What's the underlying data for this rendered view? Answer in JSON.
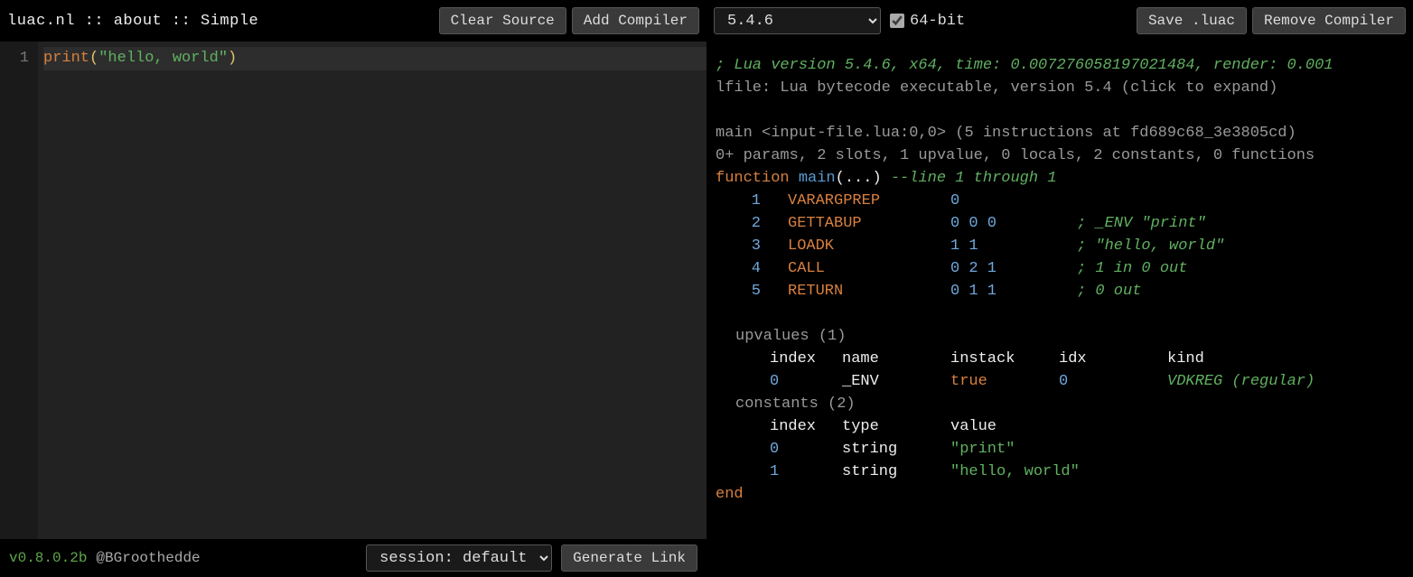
{
  "header": {
    "title": "luac.nl :: about :: Simple",
    "clear_source": "Clear Source",
    "add_compiler": "Add Compiler"
  },
  "compiler_bar": {
    "version_selected": "5.4.6",
    "arch_checked": true,
    "arch_label": "64-bit",
    "save_luac": "Save .luac",
    "remove_compiler": "Remove Compiler"
  },
  "editor": {
    "line_numbers": [
      "1"
    ],
    "code_tokens": {
      "fn": "print",
      "lparen": "(",
      "str": "\"hello, world\"",
      "rparen": ")"
    }
  },
  "footer": {
    "version": "v0.8.0.2b",
    "handle": "@BGroothedde",
    "session_label": "session: default",
    "generate_link": "Generate Link"
  },
  "output": {
    "comment_line": "; Lua version 5.4.6, x64, time: 0.007276058197021484, render: 0.001",
    "file_line": "lfile: Lua bytecode executable, version 5.4 (click to expand)",
    "main_sig": "main <input-file.lua:0,0> (5 instructions at fd689c68_3e3805cd)",
    "main_meta": "0+ params, 2 slots, 1 upvalue, 0 locals, 2 constants, 0 functions",
    "func_kw": "function",
    "func_name": "main",
    "func_args": "(...)",
    "func_comment": "--line 1 through 1",
    "instructions": [
      {
        "n": "1",
        "op": "VARARGPREP",
        "args": "0",
        "comment": ""
      },
      {
        "n": "2",
        "op": "GETTABUP",
        "args": "0 0 0",
        "comment": "; _ENV \"print\""
      },
      {
        "n": "3",
        "op": "LOADK",
        "args": "1 1",
        "comment": "; \"hello, world\""
      },
      {
        "n": "4",
        "op": "CALL",
        "args": "0 2 1",
        "comment": "; 1 in 0 out"
      },
      {
        "n": "5",
        "op": "RETURN",
        "args": "0 1 1",
        "comment": "; 0 out"
      }
    ],
    "upvalues_title": "upvalues (1)",
    "upvalues_headers": {
      "c1": "index",
      "c2": "name",
      "c3": "instack",
      "c4": "idx",
      "c5": "kind"
    },
    "upvalues": [
      {
        "index": "0",
        "name": "_ENV",
        "instack": "true",
        "idx": "0",
        "kind": "VDKREG (regular)"
      }
    ],
    "constants_title": "constants (2)",
    "constants_headers": {
      "c1": "index",
      "c2": "type",
      "c3": "value"
    },
    "constants": [
      {
        "index": "0",
        "type": "string",
        "value": "\"print\""
      },
      {
        "index": "1",
        "type": "string",
        "value": "\"hello, world\""
      }
    ],
    "end_kw": "end"
  }
}
